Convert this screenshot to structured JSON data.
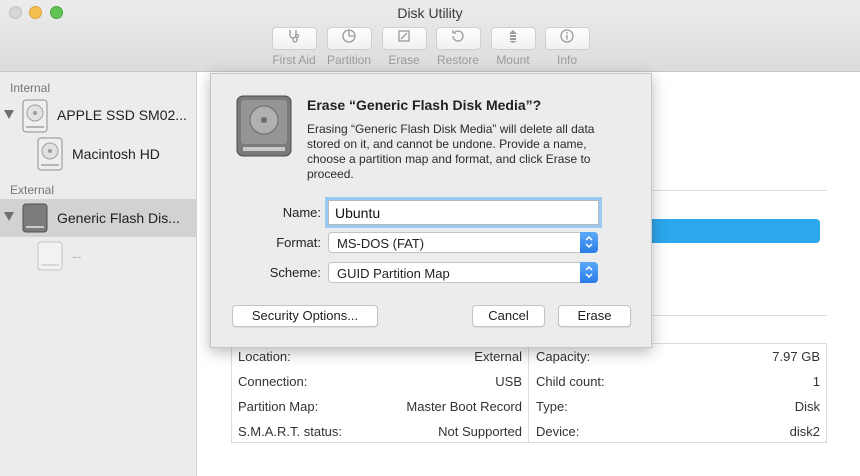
{
  "window": {
    "title": "Disk Utility"
  },
  "toolbar": {
    "items": [
      {
        "label": "First Aid",
        "icon": "stethoscope-icon"
      },
      {
        "label": "Partition",
        "icon": "pie-icon"
      },
      {
        "label": "Erase",
        "icon": "erase-icon"
      },
      {
        "label": "Restore",
        "icon": "restore-icon"
      },
      {
        "label": "Mount",
        "icon": "mount-icon"
      },
      {
        "label": "Info",
        "icon": "info-icon"
      }
    ]
  },
  "sidebar": {
    "internal_label": "Internal",
    "external_label": "External",
    "items": [
      {
        "label": "APPLE SSD SM02..."
      },
      {
        "label": "Macintosh HD"
      },
      {
        "label": "Generic Flash Dis..."
      },
      {
        "label": "--"
      }
    ]
  },
  "dialog": {
    "title": "Erase “Generic Flash Disk Media”?",
    "message": "Erasing “Generic Flash Disk Media” will delete all data stored on it, and cannot be undone. Provide a name, choose a partition map and format, and click Erase to proceed.",
    "name_label": "Name:",
    "name_value": "Ubuntu",
    "format_label": "Format:",
    "format_value": "MS-DOS (FAT)",
    "scheme_label": "Scheme:",
    "scheme_value": "GUID Partition Map",
    "security_button": "Security Options...",
    "cancel_button": "Cancel",
    "erase_button": "Erase"
  },
  "info": {
    "left": [
      {
        "key": "Location:",
        "value": "External"
      },
      {
        "key": "Connection:",
        "value": "USB"
      },
      {
        "key": "Partition Map:",
        "value": "Master Boot Record"
      },
      {
        "key": "S.M.A.R.T. status:",
        "value": "Not Supported"
      }
    ],
    "right": [
      {
        "key": "Capacity:",
        "value": "7.97 GB"
      },
      {
        "key": "Child count:",
        "value": "1"
      },
      {
        "key": "Type:",
        "value": "Disk"
      },
      {
        "key": "Device:",
        "value": "disk2"
      }
    ]
  },
  "colors": {
    "selection_gray": "#d2d2d2",
    "accent_blue": "#2ca6ec",
    "focus_ring": "#9ac9f3"
  }
}
